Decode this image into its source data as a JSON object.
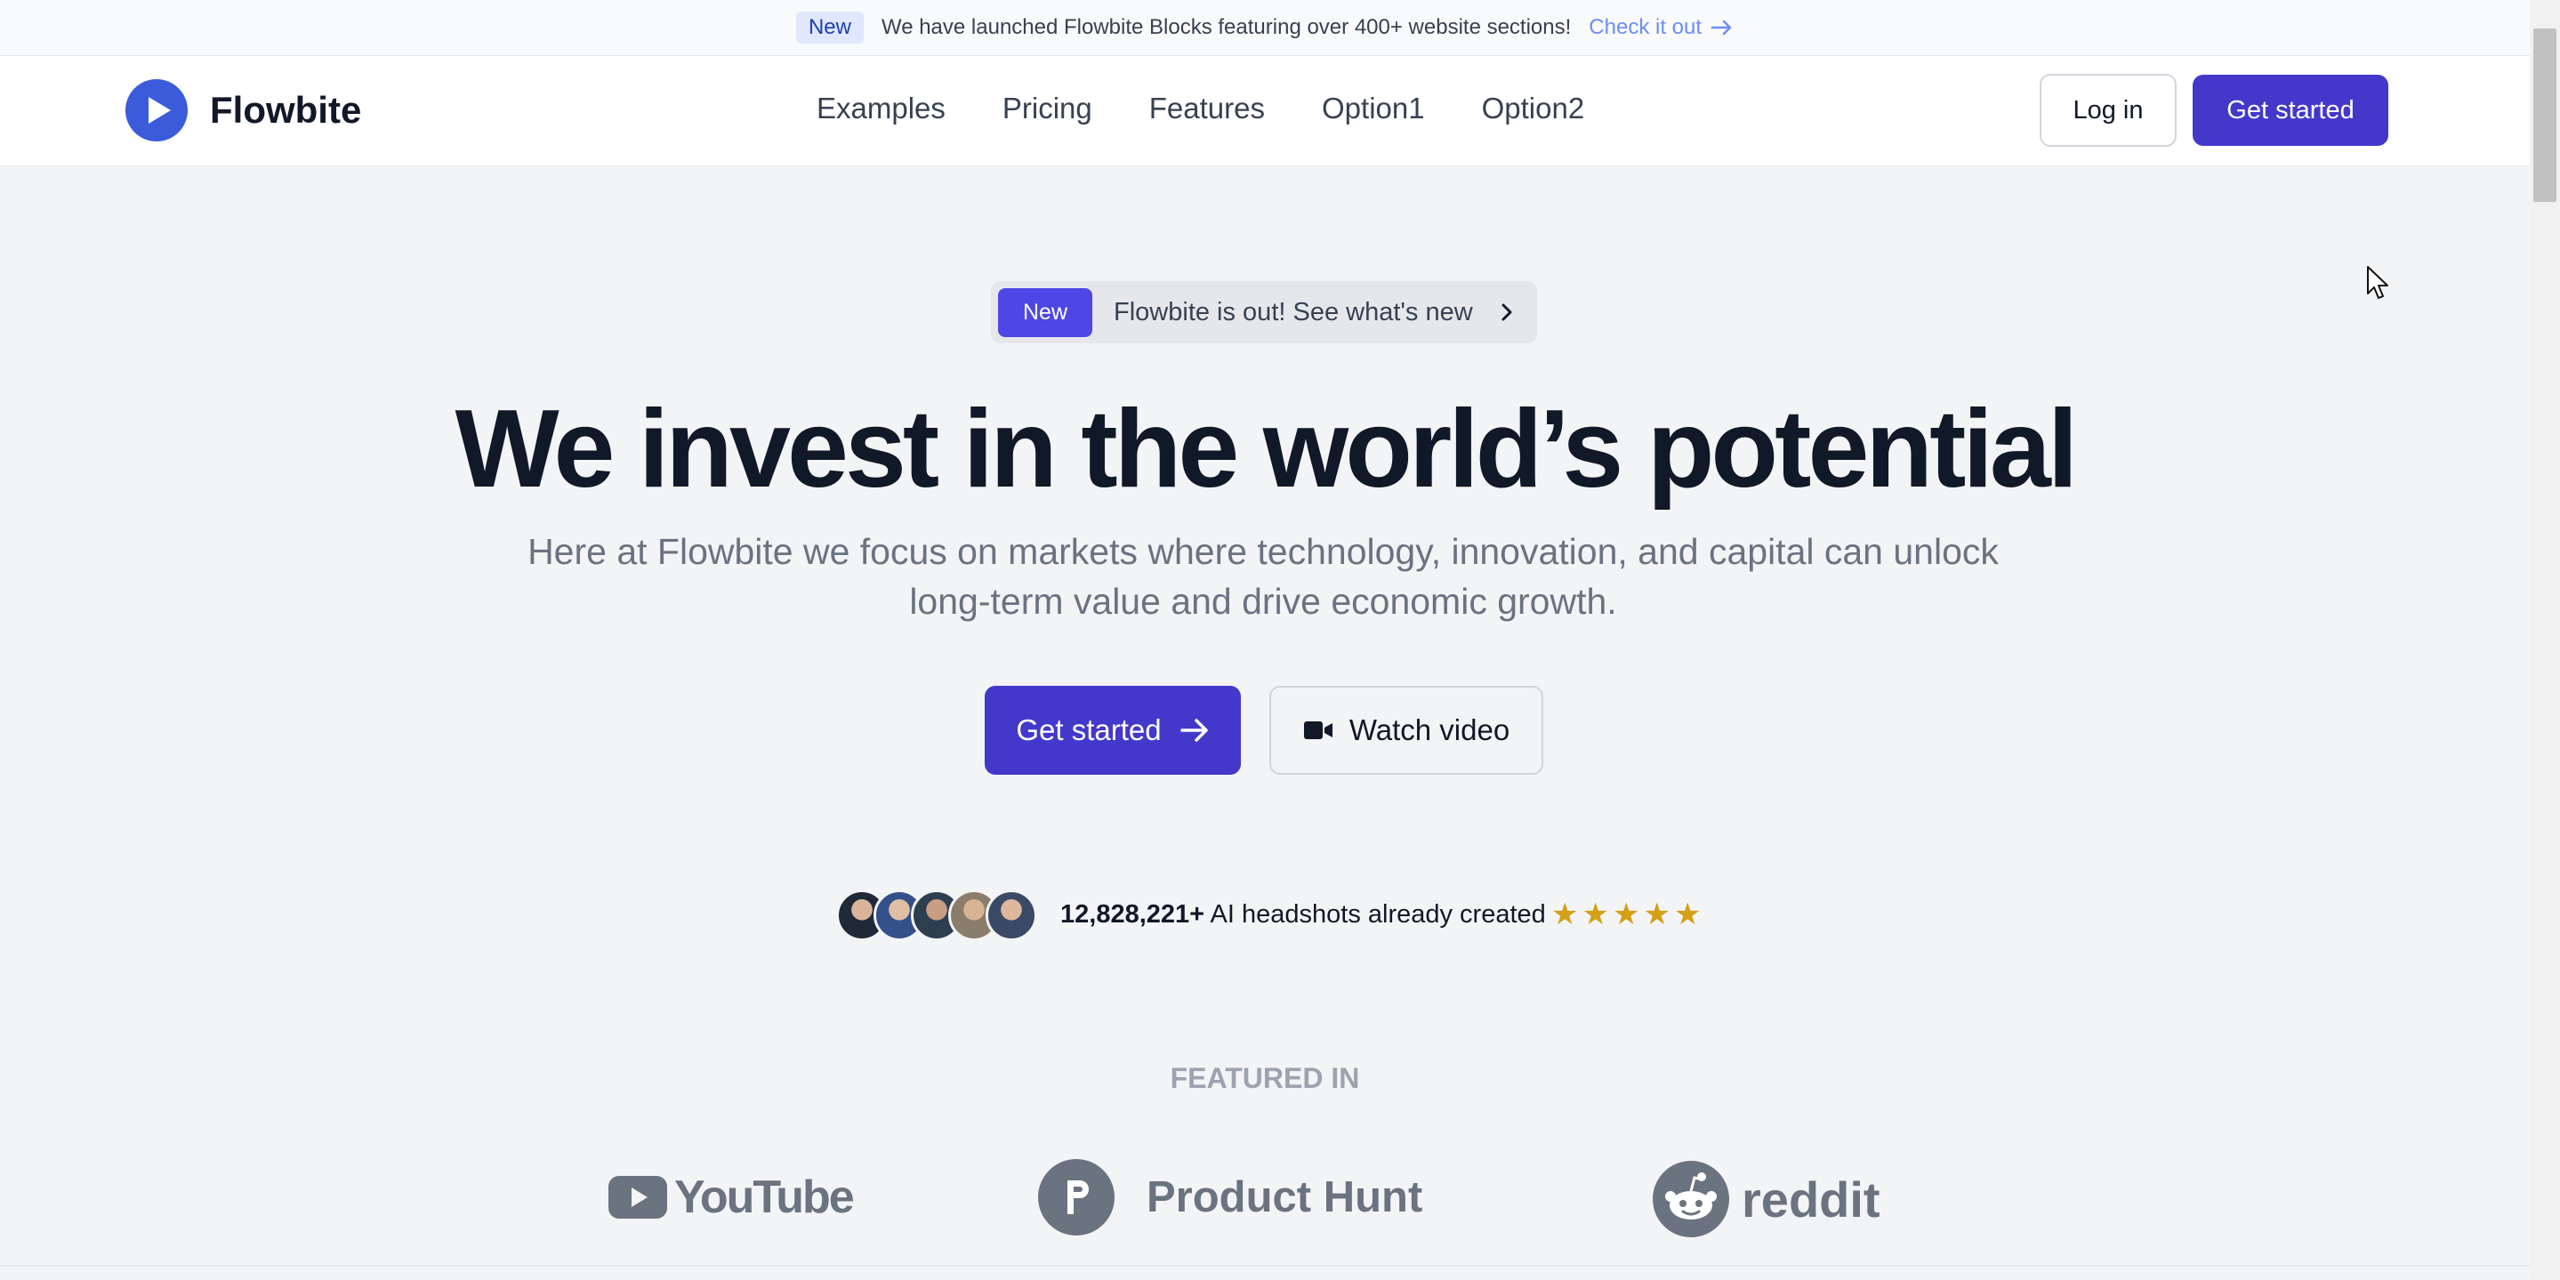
{
  "announcement": {
    "tag": "New",
    "message": "We have launched Flowbite Blocks featuring over 400+ website sections!",
    "link": "Check it out"
  },
  "nav": {
    "brand": "Flowbite",
    "menu": [
      "Examples",
      "Pricing",
      "Features",
      "Option1",
      "Option2"
    ],
    "login": "Log in",
    "get_started": "Get started"
  },
  "hero": {
    "pill_tag": "New",
    "pill_text": "Flowbite is out! See what's new",
    "headline": "We invest in the world’s potential",
    "subline": "Here at Flowbite we focus on markets where technology, innovation, and capital can unlock long-term value and drive economic growth.",
    "cta_primary": "Get started",
    "cta_secondary": "Watch video"
  },
  "social_proof": {
    "count": "12,828,221+",
    "text": " AI headshots already created",
    "rating": 5
  },
  "featured": {
    "title": "FEATURED IN",
    "brands": [
      "YouTube",
      "Product Hunt",
      "reddit"
    ]
  },
  "colors": {
    "primary": "#4338ca",
    "accent": "#4f46e5",
    "star": "#d4a017",
    "background": "#f3f4f6"
  }
}
